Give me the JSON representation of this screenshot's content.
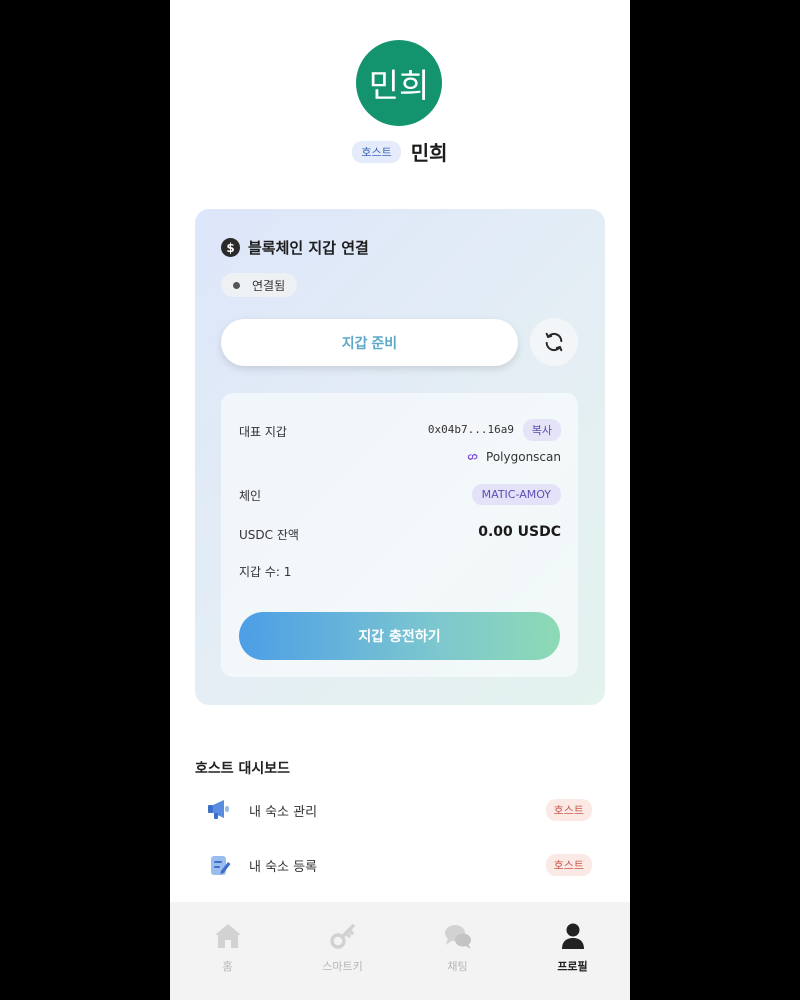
{
  "profile": {
    "avatar_text": "민희",
    "role_badge": "호스트",
    "name": "민희"
  },
  "wallet": {
    "title": "블록체인 지갑 연결",
    "status": "연결됨",
    "ready_button": "지갑 준비",
    "rep_wallet_label": "대표 지갑",
    "address": "0x04b7...16a9",
    "copy_label": "복사",
    "explorer_link": "Polygonscan",
    "chain_label": "체인",
    "chain_value": "MATIC-AMOY",
    "balance_label": "USDC 잔액",
    "balance_value": "0.00 USDC",
    "wallet_count": "지갑 수: 1",
    "charge_button": "지갑 충전하기"
  },
  "dashboard": {
    "title": "호스트 대시보드",
    "items": [
      {
        "label": "내 숙소 관리",
        "badge": "호스트",
        "icon": "megaphone-icon"
      },
      {
        "label": "내 숙소 등록",
        "badge": "호스트",
        "icon": "edit-document-icon"
      }
    ]
  },
  "nav": {
    "items": [
      {
        "label": "홈",
        "icon": "home-icon"
      },
      {
        "label": "스마트키",
        "icon": "key-icon"
      },
      {
        "label": "채팅",
        "icon": "chat-icon"
      },
      {
        "label": "프로필",
        "icon": "person-icon",
        "active": true
      }
    ]
  },
  "colors": {
    "avatar": "#14946e",
    "accent_blue": "#4c9ee6",
    "accent_green": "#8ddab5",
    "host_badge": "#c85a4b"
  }
}
